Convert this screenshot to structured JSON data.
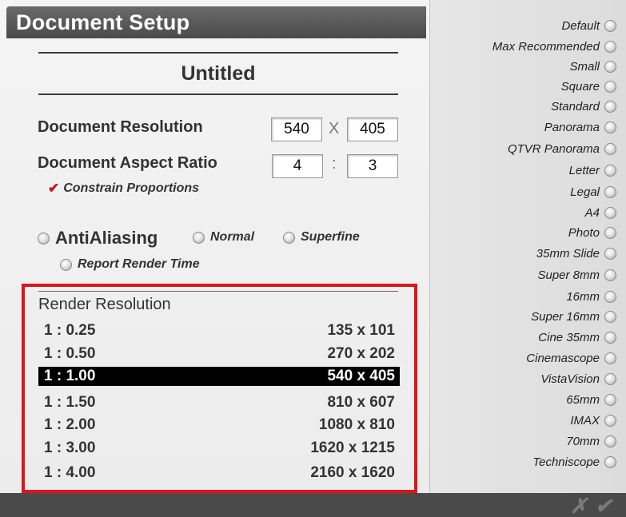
{
  "window": {
    "title": "Document Setup"
  },
  "document": {
    "name": "Untitled"
  },
  "resolution": {
    "label": "Document Resolution",
    "width": "540",
    "height": "405",
    "separator": "X"
  },
  "aspect": {
    "label": "Document Aspect Ratio",
    "w": "4",
    "h": "3",
    "separator": ":",
    "constrain_label": "Constrain Proportions",
    "constrain_checked": true
  },
  "antialias": {
    "label": "AntiAliasing",
    "normal_label": "Normal",
    "superfine_label": "Superfine",
    "report_label": "Report Render Time"
  },
  "render": {
    "title": "Render Resolution",
    "selected_index": 2,
    "rows": [
      {
        "ratio": "1 : 0.25",
        "size": "135 x 101"
      },
      {
        "ratio": "1 : 0.50",
        "size": "270 x 202"
      },
      {
        "ratio": "1 : 1.00",
        "size": "540 x 405"
      },
      {
        "ratio": "1 : 1.50",
        "size": "810 x 607"
      },
      {
        "ratio": "1 : 2.00",
        "size": "1080 x 810"
      },
      {
        "ratio": "1 : 3.00",
        "size": "1620 x 1215"
      },
      {
        "ratio": "1 : 4.00",
        "size": "2160 x 1620"
      }
    ]
  },
  "presets": [
    "Default",
    "Max Recommended",
    "Small",
    "Square",
    "Standard",
    "Panorama",
    "QTVR Panorama",
    "Letter",
    "Legal",
    "A4",
    "Photo",
    "35mm Slide",
    "Super 8mm",
    "16mm",
    "Super 16mm",
    "Cine 35mm",
    "Cinemascope",
    "VistaVision",
    "65mm",
    "IMAX",
    "70mm",
    "Techniscope"
  ],
  "buttons": {
    "cancel_label": "✗",
    "ok_label": "✔"
  },
  "colors": {
    "highlight_border": "#e0141a",
    "selected_row_bg": "#000000",
    "checkmark": "#c2161b"
  }
}
